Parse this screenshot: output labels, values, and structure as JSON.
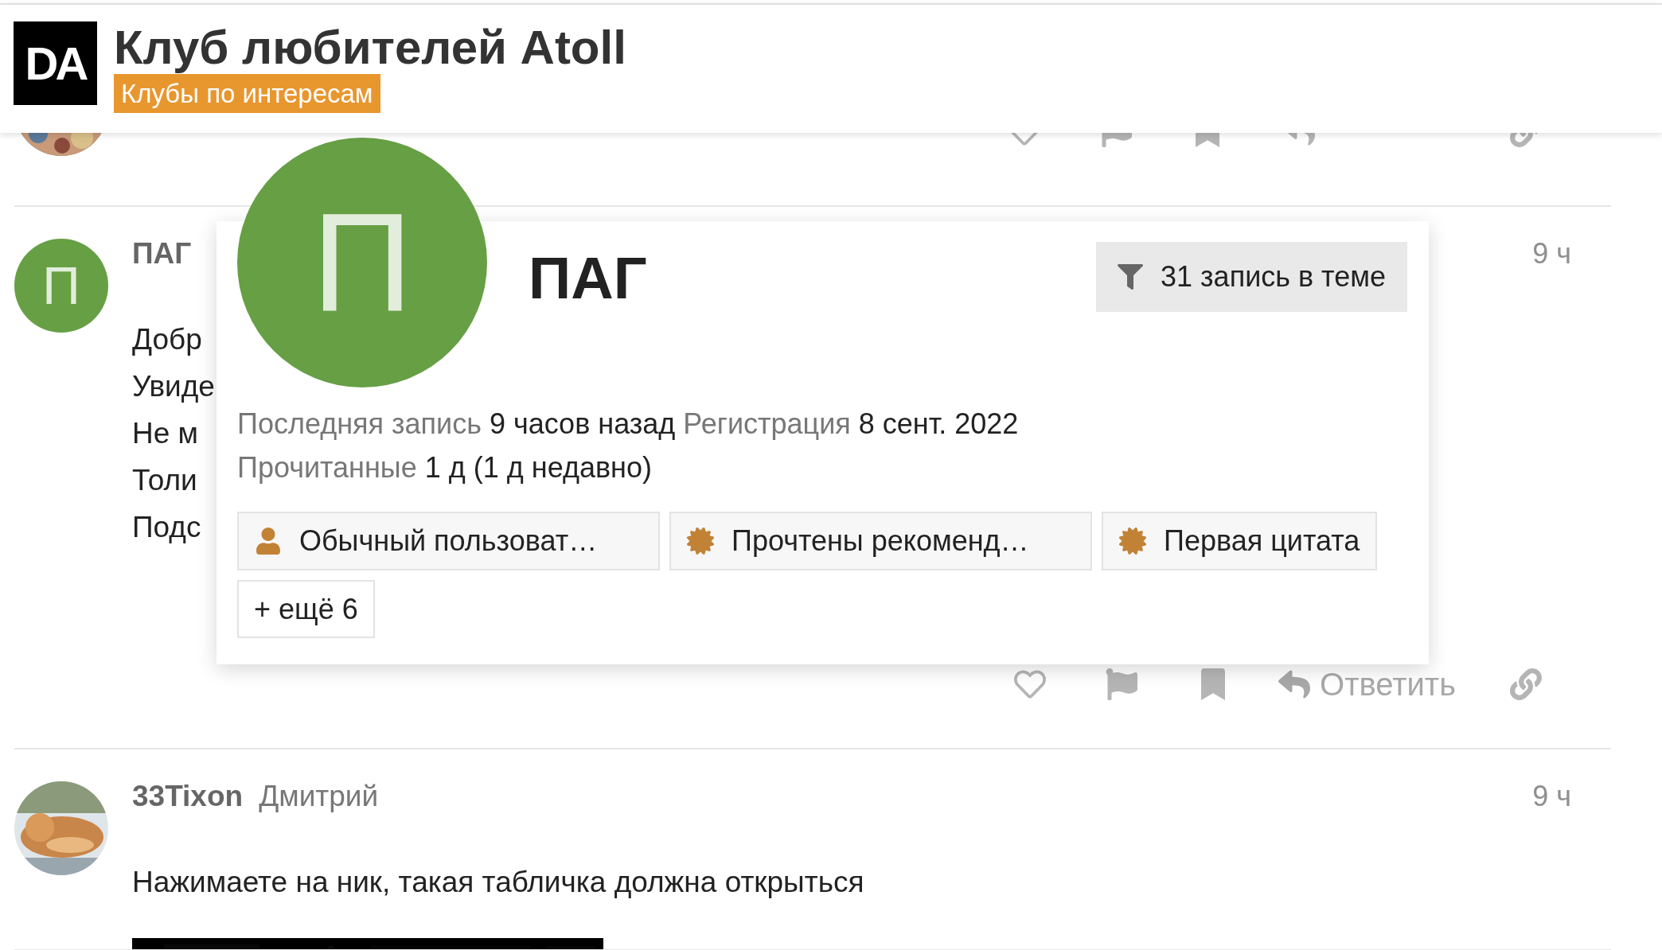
{
  "header": {
    "logo": "DA",
    "title": "Клуб любителей Atoll",
    "category": {
      "label": "Клубы по интересам",
      "color": "#e8962e"
    }
  },
  "posts": [
    {
      "kind": "tail",
      "avatar": {
        "kind": "picture"
      }
    },
    {
      "kind": "full",
      "username": "ПАГ",
      "avatar": {
        "kind": "letter",
        "letter": "П",
        "color": "#679f45"
      },
      "time": "9 ч",
      "lines": [
        "Добр",
        "Увиде",
        "Не м",
        "Толи",
        "Подс"
      ],
      "actions": {
        "reply": "Ответить"
      }
    },
    {
      "kind": "full",
      "username": "33Tixon",
      "full_name": "Дмитрий",
      "avatar": {
        "kind": "picture"
      },
      "time": "9 ч",
      "lines": [
        "Нажимаете на ник, такая табличка должна открыться"
      ],
      "attachment": {
        "kind": "picture"
      }
    }
  ],
  "user_card": {
    "avatar": {
      "letter": "П",
      "color": "#679f45"
    },
    "name": "ПАГ",
    "filter_button": "31 запись в теме",
    "meta": [
      [
        {
          "label": "Последняя запись",
          "value": "9 часов назад"
        },
        {
          "label": "Регистрация",
          "value": "8 сент. 2022"
        }
      ],
      [
        {
          "label": "Прочитанные",
          "value": "1 д (1 д недавно)"
        }
      ]
    ],
    "badges": [
      {
        "kind": "user",
        "label": "Обычный пользоват…"
      },
      {
        "kind": "certificate",
        "label": "Прочтены рекоменд…"
      },
      {
        "kind": "certificate",
        "label": "Первая цитата"
      }
    ],
    "more_button": "+ ещё 6"
  }
}
